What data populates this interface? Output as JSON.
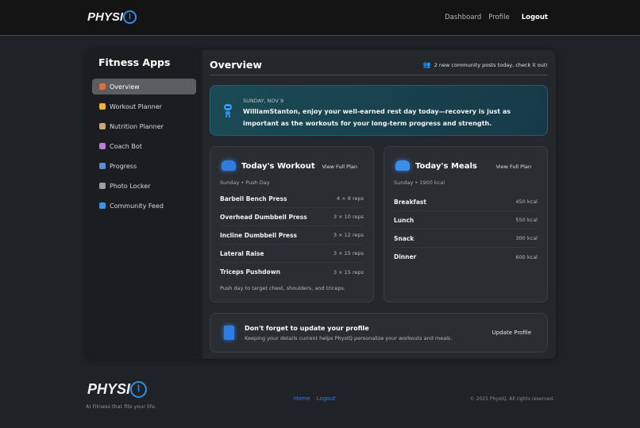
{
  "brand": {
    "name": "PHYSI",
    "q": "Q",
    "tagline": "AI Fitness that fits your life."
  },
  "nav": {
    "dashboard": "Dashboard",
    "profile": "Profile",
    "logout": "Logout"
  },
  "sidebar": {
    "title": "Fitness Apps",
    "items": [
      {
        "label": "Overview",
        "icon": "house-icon",
        "color": "#e0703a"
      },
      {
        "label": "Workout Planner",
        "icon": "flexed-biceps-icon",
        "color": "#f2b233"
      },
      {
        "label": "Nutrition Planner",
        "icon": "bowl-icon",
        "color": "#c9a77a"
      },
      {
        "label": "Coach Bot",
        "icon": "robot-icon",
        "color": "#c07ad8"
      },
      {
        "label": "Progress",
        "icon": "bar-chart-icon",
        "color": "#5b8fd8"
      },
      {
        "label": "Photo Locker",
        "icon": "file-box-icon",
        "color": "#9aa0a8"
      },
      {
        "label": "Community Feed",
        "icon": "globe-icon",
        "color": "#3a95e0"
      }
    ]
  },
  "main": {
    "title": "Overview",
    "community": "2 new community posts today, check it out!",
    "banner": {
      "date": "SUNDAY, NOV 9",
      "message": "WilliamStanton, enjoy your well-earned rest day today—recovery is just as important as the workouts for your long-term progress and strength."
    },
    "workout": {
      "title": "Today's Workout",
      "link": "View Full Plan",
      "subtitle": "Sunday • Push Day",
      "items": [
        {
          "name": "Barbell Bench Press",
          "value": "4 × 8 reps"
        },
        {
          "name": "Overhead Dumbbell Press",
          "value": "3 × 10 reps"
        },
        {
          "name": "Incline Dumbbell Press",
          "value": "3 × 12 reps"
        },
        {
          "name": "Lateral Raise",
          "value": "3 × 15 reps"
        },
        {
          "name": "Triceps Pushdown",
          "value": "3 × 15 reps"
        }
      ],
      "note": "Push day to target chest, shoulders, and triceps."
    },
    "meals": {
      "title": "Today's Meals",
      "link": "View Full Plan",
      "subtitle": "Sunday • 1900 kcal",
      "items": [
        {
          "name": "Breakfast",
          "value": "450 kcal"
        },
        {
          "name": "Lunch",
          "value": "550 kcal"
        },
        {
          "name": "Snack",
          "value": "300 kcal"
        },
        {
          "name": "Dinner",
          "value": "600 kcal"
        }
      ]
    },
    "profile": {
      "title": "Don't forget to update your profile",
      "subtitle": "Keeping your details current helps PhysIQ personalize your workouts and meals.",
      "button": "Update Profile"
    }
  },
  "footer": {
    "home": "Home",
    "logout": "Logout",
    "copyright": "© 2025 PhysIQ. All rights reserved."
  }
}
